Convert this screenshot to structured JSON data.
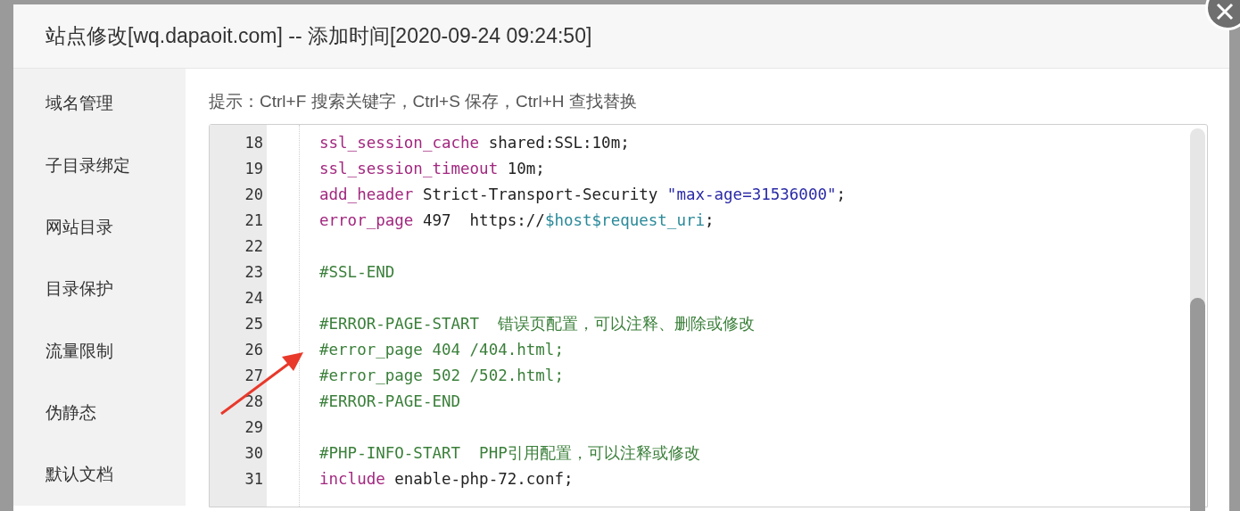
{
  "dialog": {
    "title": "站点修改[wq.dapaoit.com] -- 添加时间[2020-09-24 09:24:50]"
  },
  "sidebar": {
    "items": [
      "域名管理",
      "子目录绑定",
      "网站目录",
      "目录保护",
      "流量限制",
      "伪静态",
      "默认文档"
    ]
  },
  "hint": "提示：Ctrl+F 搜索关键字，Ctrl+S 保存，Ctrl+H 查找替换",
  "editor": {
    "lines": [
      {
        "number": "18",
        "tokens": [
          {
            "kind": "keyword",
            "text": "ssl_session_cache"
          },
          {
            "kind": "plain",
            "text": " shared:SSL:10m;"
          }
        ]
      },
      {
        "number": "19",
        "tokens": [
          {
            "kind": "keyword",
            "text": "ssl_session_timeout"
          },
          {
            "kind": "plain",
            "text": " 10m;"
          }
        ]
      },
      {
        "number": "20",
        "tokens": [
          {
            "kind": "keyword",
            "text": "add_header"
          },
          {
            "kind": "plain",
            "text": " Strict-Transport-Security "
          },
          {
            "kind": "string",
            "text": "\"max-age=31536000\""
          },
          {
            "kind": "plain",
            "text": ";"
          }
        ]
      },
      {
        "number": "21",
        "tokens": [
          {
            "kind": "keyword",
            "text": "error_page"
          },
          {
            "kind": "plain",
            "text": " 497  https://"
          },
          {
            "kind": "variable",
            "text": "$host$request_uri"
          },
          {
            "kind": "plain",
            "text": ";"
          }
        ]
      },
      {
        "number": "22"
      },
      {
        "number": "23",
        "tokens": [
          {
            "kind": "comment",
            "text": "#SSL-END"
          }
        ]
      },
      {
        "number": "24"
      },
      {
        "number": "25",
        "tokens": [
          {
            "kind": "comment",
            "text": "#ERROR-PAGE-START  错误页配置，可以注释、删除或修改"
          }
        ]
      },
      {
        "number": "26",
        "tokens": [
          {
            "kind": "comment",
            "text": "#error_page 404 /404.html;"
          }
        ]
      },
      {
        "number": "27",
        "tokens": [
          {
            "kind": "comment",
            "text": "#error_page 502 /502.html;"
          }
        ]
      },
      {
        "number": "28",
        "tokens": [
          {
            "kind": "comment",
            "text": "#ERROR-PAGE-END"
          }
        ]
      },
      {
        "number": "29"
      },
      {
        "number": "30",
        "tokens": [
          {
            "kind": "comment",
            "text": "#PHP-INFO-START  PHP引用配置，可以注释或修改"
          }
        ]
      },
      {
        "number": "31",
        "tokens": [
          {
            "kind": "keyword",
            "text": "include"
          },
          {
            "kind": "plain",
            "text": " enable-php-72.conf;"
          }
        ]
      }
    ]
  }
}
